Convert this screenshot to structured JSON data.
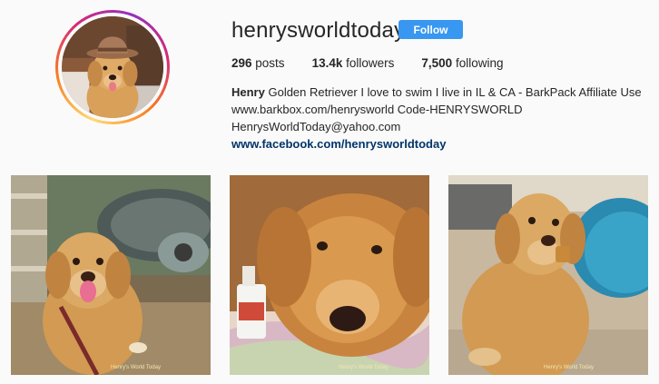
{
  "profile": {
    "username": "henrysworldtoday",
    "follow_label": "Follow",
    "avatar_icon": "avatar-dog-in-hat"
  },
  "stats": {
    "posts_count": "296",
    "posts_label": " posts",
    "followers_count": "13.4k",
    "followers_label": " followers",
    "following_count": "7,500",
    "following_label": " following"
  },
  "bio": {
    "name": "Henry",
    "line1": " Golden Retriever I love to swim I live in IL & CA - BarkPack Affiliate Use",
    "line2": "www.barkbox.com/henrysworld Code-HENRYSWORLD",
    "line3": "HenrysWorldToday@yahoo.com",
    "link": "www.facebook.com/henrysworldtoday"
  },
  "posts": [
    {
      "watermark": "Henry's World Today",
      "description": "dog sitting by tortoise statue"
    },
    {
      "watermark": "Henry's World Today",
      "description": "dog lying on blanket"
    },
    {
      "watermark": "Henry's World Today",
      "description": "dog holding treat by pool"
    }
  ],
  "colors": {
    "follow_button": "#3897f0",
    "link": "#003569",
    "background": "#fafafa",
    "fur": "#d9a05a"
  }
}
